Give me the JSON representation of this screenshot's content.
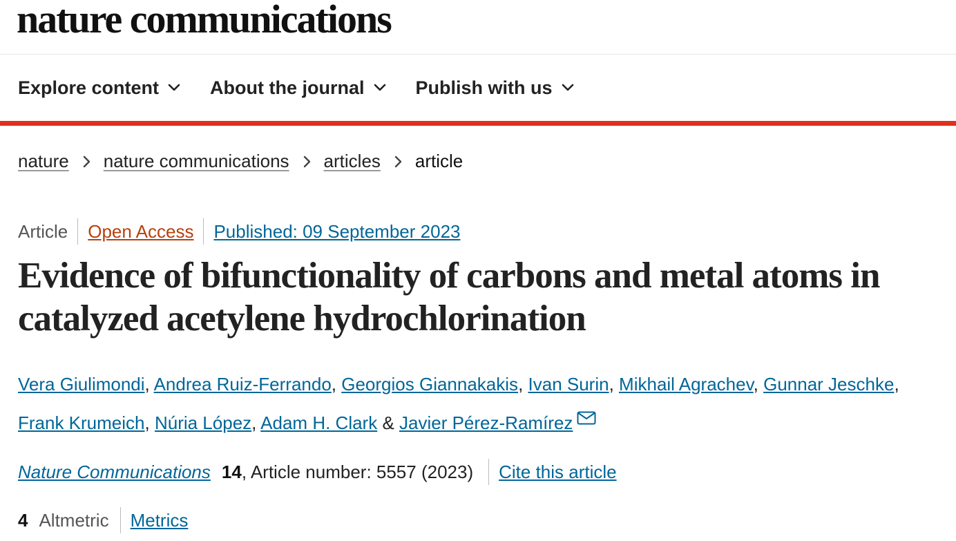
{
  "header": {
    "logo": "nature communications"
  },
  "nav": {
    "items": [
      {
        "label": "Explore content",
        "icon": "chevron-down-icon"
      },
      {
        "label": "About the journal",
        "icon": "chevron-down-icon"
      },
      {
        "label": "Publish with us",
        "icon": "chevron-down-icon"
      }
    ],
    "accent_color": "#e0301e"
  },
  "breadcrumb": {
    "items": [
      "nature",
      "nature communications",
      "articles"
    ],
    "current": "article"
  },
  "article": {
    "type": "Article",
    "access": "Open Access",
    "published": "Published: 09 September 2023",
    "title": "Evidence of bifunctionality of carbons and metal atoms in catalyzed acetylene hydrochlorination",
    "authors": [
      "Vera Giulimondi",
      "Andrea Ruiz-Ferrando",
      "Georgios Giannakakis",
      "Ivan Surin",
      "Mikhail Agrachev",
      "Gunnar Jeschke",
      "Frank Krumeich",
      "Núria López",
      "Adam H. Clark",
      "Javier Pérez-Ramírez"
    ],
    "author_separator": ", ",
    "last_separator": " & ",
    "journal": "Nature Communications",
    "volume": "14",
    "article_number": ", Article number: 5557 (2023)",
    "cite_label": "Cite this article",
    "altmetric_count": "4",
    "altmetric_label": "Altmetric",
    "metrics_label": "Metrics"
  },
  "colors": {
    "link": "#006699",
    "open_access": "#b7410e",
    "accent": "#e0301e"
  }
}
